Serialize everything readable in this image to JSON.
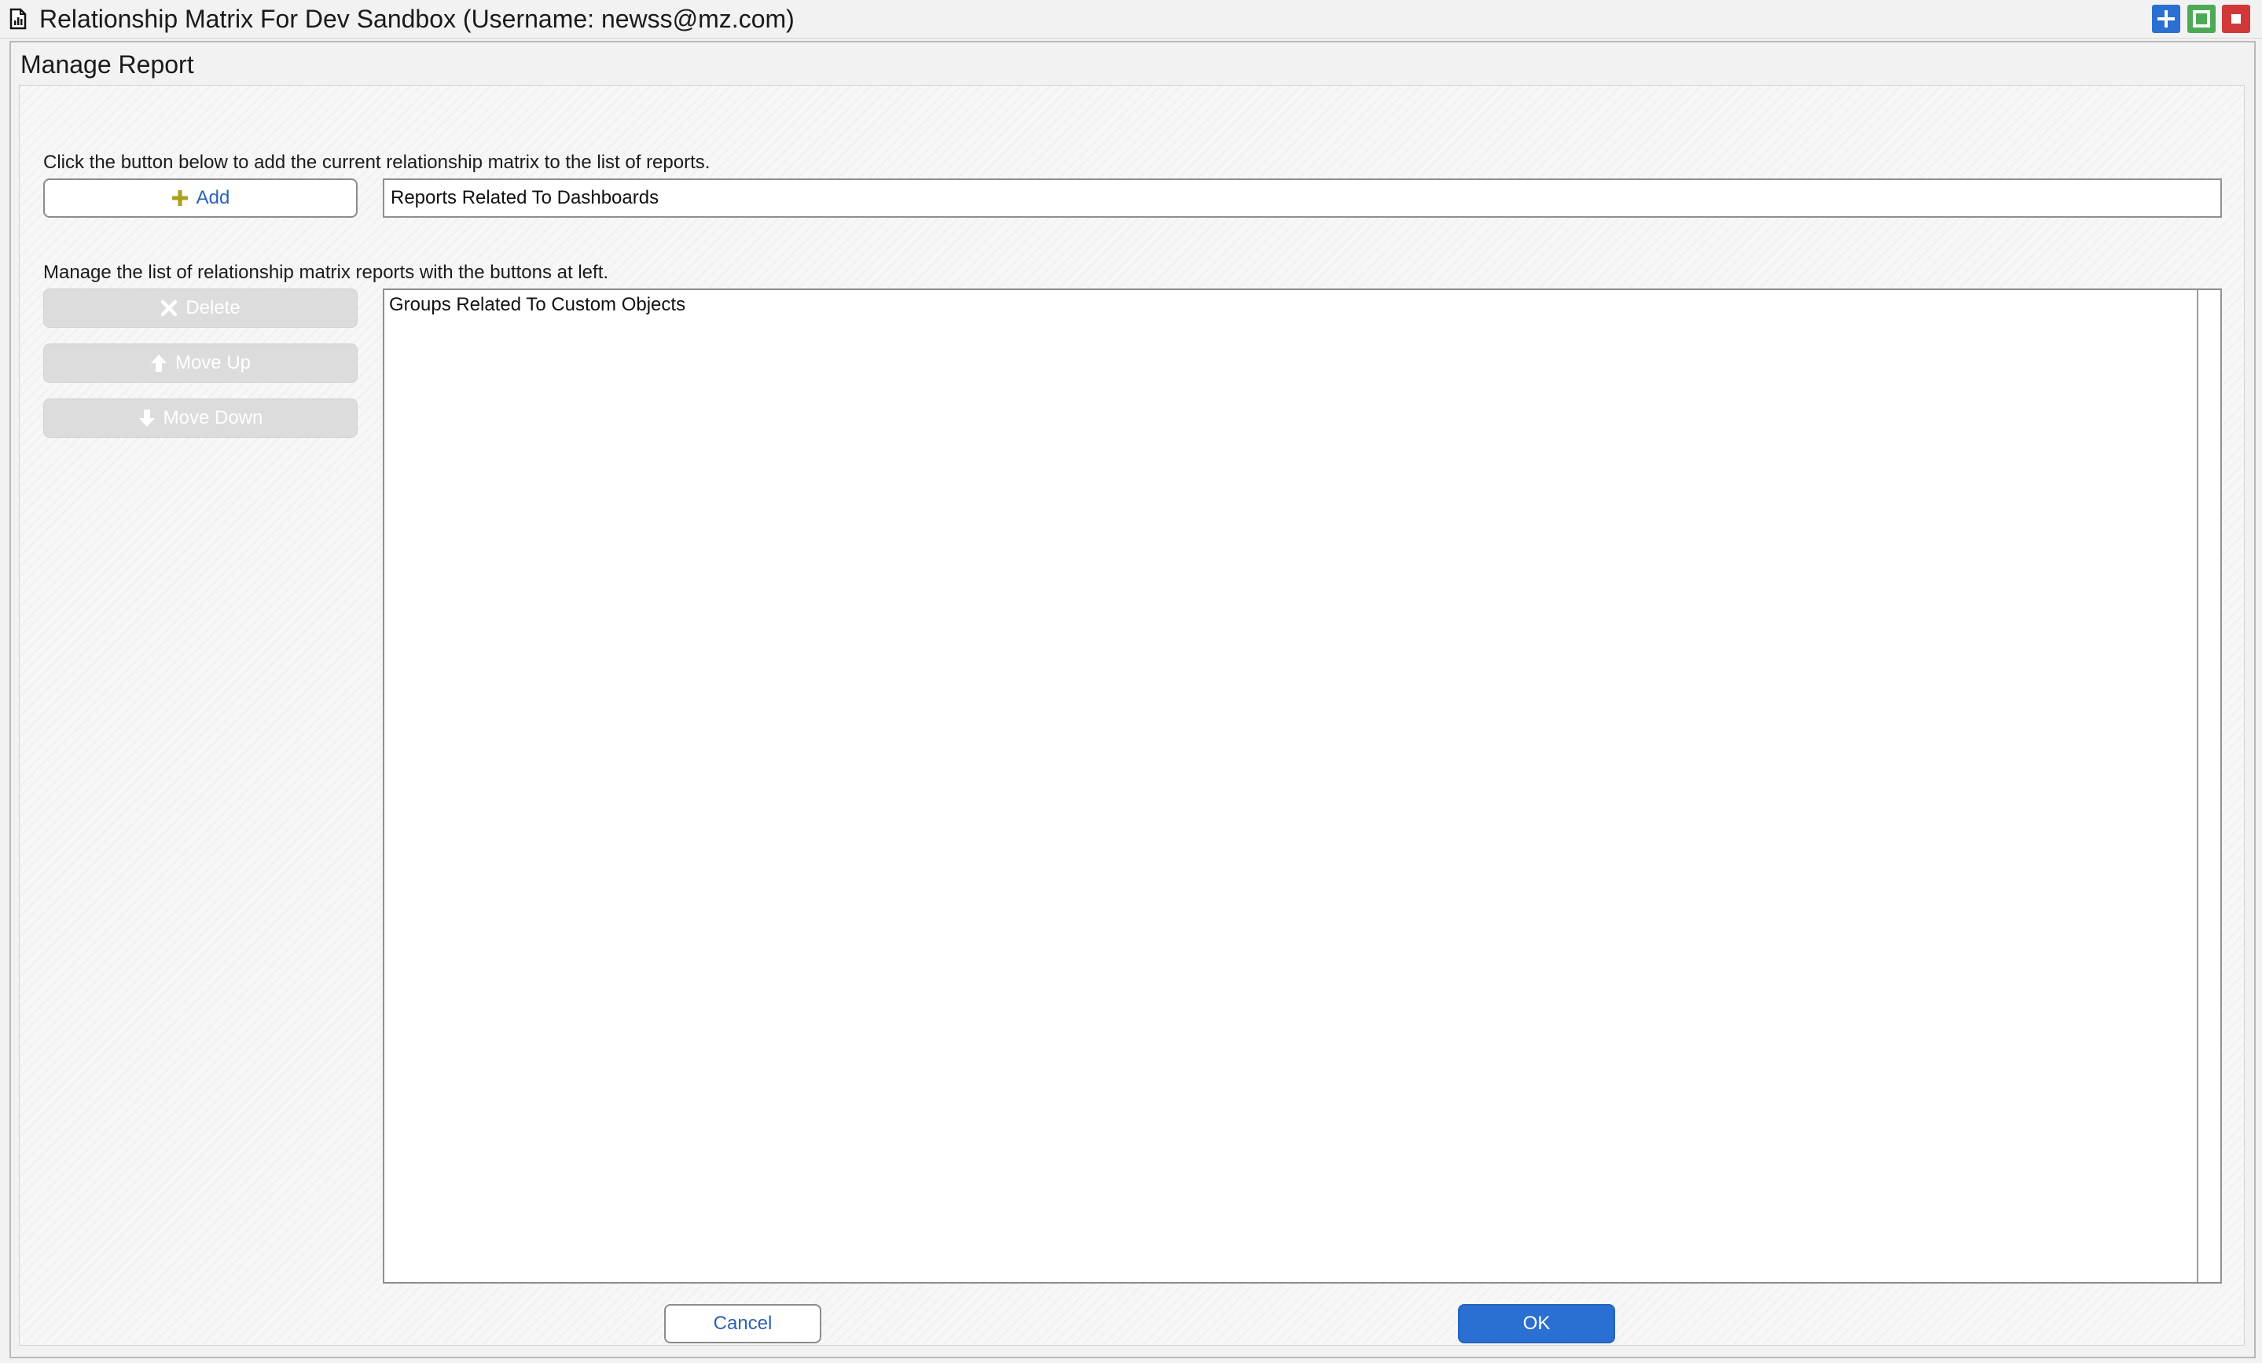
{
  "window": {
    "title": "Relationship Matrix For Dev Sandbox (Username: newss@mz.com)",
    "icon": "report-document-icon",
    "controls": {
      "maximize_icon": "plus-icon",
      "restore_icon": "square-icon",
      "close_icon": "stop-icon"
    }
  },
  "panel": {
    "title": "Manage Report"
  },
  "add_section": {
    "instruction": "Click the button below to add the current relationship matrix to the list of reports.",
    "add_button_label": "Add",
    "report_name_value": "Reports Related To Dashboards"
  },
  "manage_section": {
    "instruction": "Manage the list of relationship matrix reports with the buttons at left.",
    "delete_label": "Delete",
    "move_up_label": "Move Up",
    "move_down_label": "Move Down",
    "reports": [
      "Groups Related To Custom Objects"
    ]
  },
  "footer": {
    "cancel_label": "Cancel",
    "ok_label": "OK"
  },
  "colors": {
    "accent_blue": "#2a6fd1",
    "add_icon_olive": "#a8a21a",
    "restore_green": "#4caa55",
    "close_red": "#d0383a"
  }
}
